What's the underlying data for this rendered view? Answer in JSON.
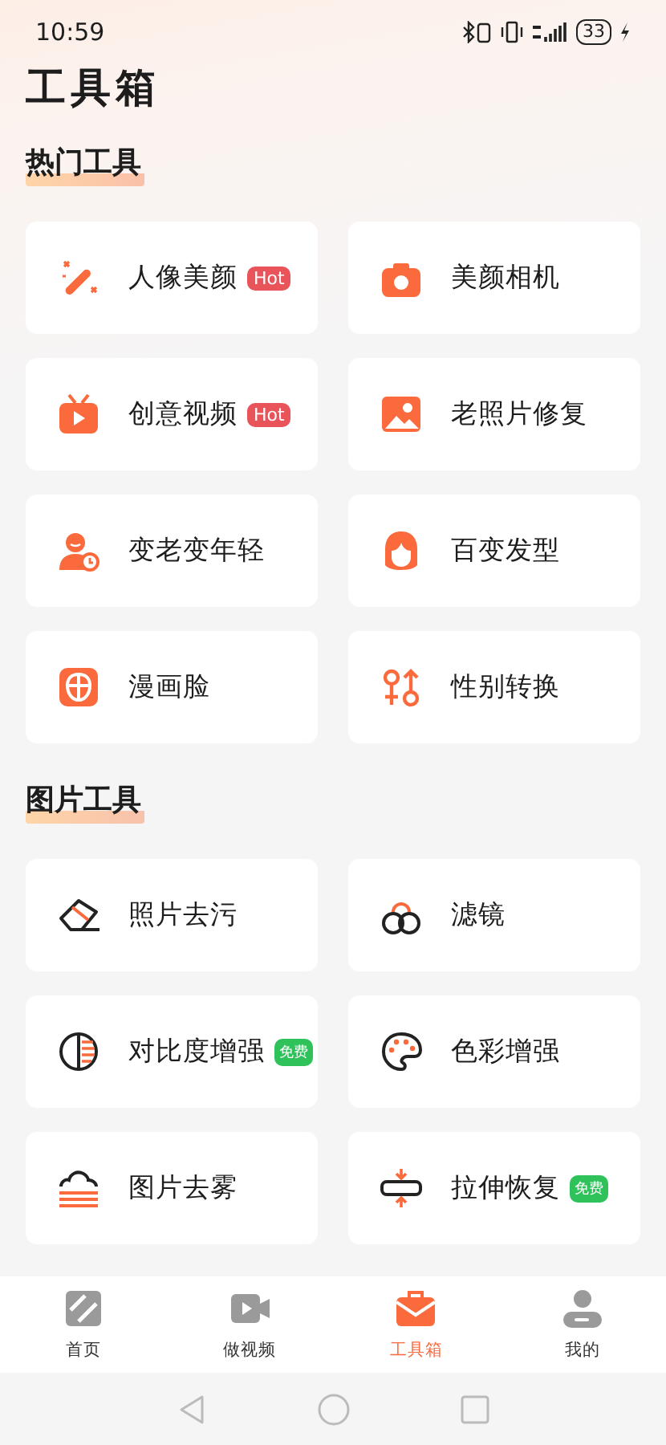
{
  "status_bar": {
    "time": "10:59",
    "battery": "33"
  },
  "title": "工具箱",
  "sections": [
    {
      "heading": "热门工具",
      "tools": [
        {
          "label": "人像美颜",
          "badge": {
            "text": "Hot",
            "kind": "hot"
          }
        },
        {
          "label": "美颜相机"
        },
        {
          "label": "创意视频",
          "badge": {
            "text": "Hot",
            "kind": "hot"
          }
        },
        {
          "label": "老照片修复"
        },
        {
          "label": "变老变年轻"
        },
        {
          "label": "百变发型"
        },
        {
          "label": "漫画脸"
        },
        {
          "label": "性别转换"
        }
      ]
    },
    {
      "heading": "图片工具",
      "tools": [
        {
          "label": "照片去污"
        },
        {
          "label": "滤镜"
        },
        {
          "label": "对比度增强",
          "badge": {
            "text": "免费",
            "kind": "free"
          }
        },
        {
          "label": "色彩增强"
        },
        {
          "label": "图片去雾"
        },
        {
          "label": "拉伸恢复",
          "badge": {
            "text": "免费",
            "kind": "free"
          }
        }
      ]
    }
  ],
  "tabs": [
    {
      "label": "首页",
      "selected": false
    },
    {
      "label": "做视频",
      "selected": false
    },
    {
      "label": "工具箱",
      "selected": true
    },
    {
      "label": "我的",
      "selected": false
    }
  ]
}
